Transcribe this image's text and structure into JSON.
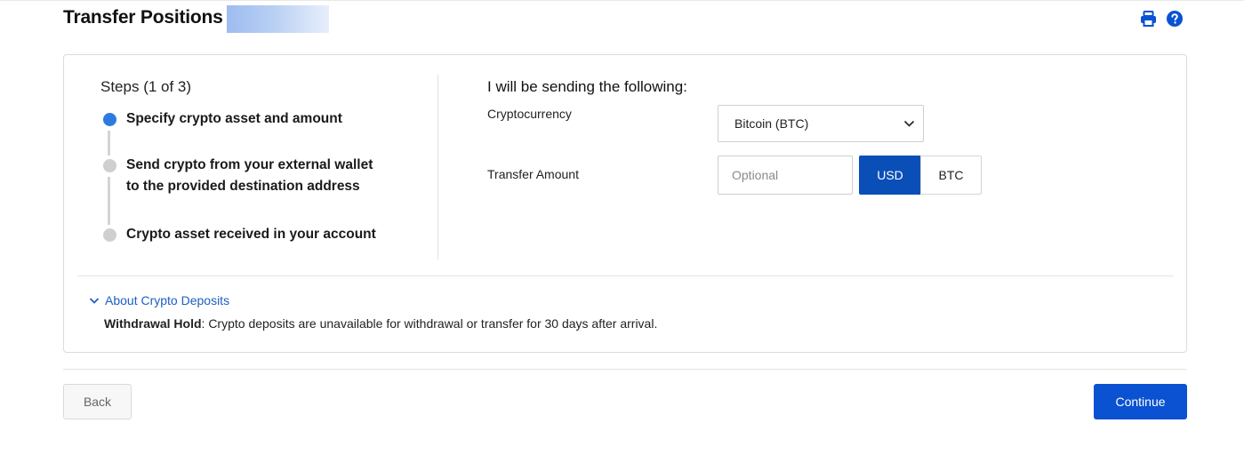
{
  "header": {
    "title": "Transfer Positions",
    "icons": [
      "print-icon",
      "help-icon"
    ],
    "accent_color": "#0a52d1"
  },
  "steps": {
    "title": "Steps (1 of 3)",
    "current": 1,
    "total": 3,
    "items": [
      {
        "line1": "Specify crypto asset and amount",
        "line2": "",
        "state": "active"
      },
      {
        "line1": "Send crypto from your external wallet",
        "line2": "to the provided destination address",
        "state": "pending"
      },
      {
        "line1": "Crypto asset received in your account",
        "line2": "",
        "state": "pending"
      }
    ]
  },
  "form": {
    "title": "I will be sending the following:",
    "crypto_label": "Cryptocurrency",
    "crypto_value": "Bitcoin (BTC)",
    "amount_label": "Transfer Amount",
    "amount_value": "",
    "amount_placeholder": "Optional",
    "units": [
      {
        "label": "USD",
        "selected": true
      },
      {
        "label": "BTC",
        "selected": false
      }
    ]
  },
  "info": {
    "about_label": "About Crypto Deposits",
    "hold_label": "Withdrawal Hold",
    "hold_text": ": Crypto deposits are unavailable for withdrawal or transfer for 30 days after arrival."
  },
  "footer": {
    "back_label": "Back",
    "continue_label": "Continue"
  }
}
